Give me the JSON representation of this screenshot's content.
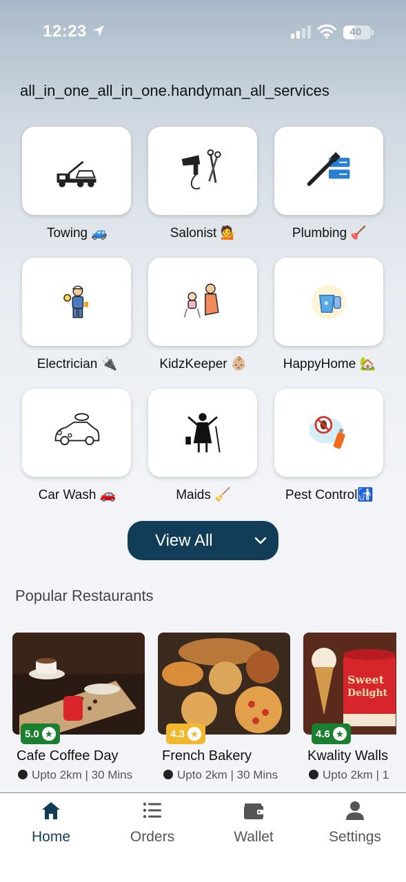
{
  "status_bar": {
    "time": "12:23",
    "battery": "40",
    "battery_level": 0.4
  },
  "app_title": "all_in_one_all_in_one.handyman_all_services",
  "services": [
    {
      "label": "Towing 🚙",
      "icon": "tow-truck-icon"
    },
    {
      "label": "Salonist 💁",
      "icon": "hair-dryer-icon"
    },
    {
      "label": "Plumbing 🪠",
      "icon": "wrench-pipe-icon"
    },
    {
      "label": "Electrician 🔌",
      "icon": "electrician-icon"
    },
    {
      "label": "KidzKeeper 👶🏼",
      "icon": "babysitter-icon"
    },
    {
      "label": "HappyHome 🏡",
      "icon": "cleaning-bucket-icon"
    },
    {
      "label": "Car Wash 🚗",
      "icon": "car-wash-icon"
    },
    {
      "label": "Maids 🧹",
      "icon": "maid-icon"
    },
    {
      "label": "Pest Control🚮",
      "icon": "pest-spray-icon"
    }
  ],
  "view_all": {
    "label": "View All"
  },
  "popular_restaurants": {
    "title": "Popular Restaurants",
    "items": [
      {
        "name": "Cafe Coffee Day",
        "rating": "5.0",
        "rating_color": "#1a7f2e",
        "meta": "Upto 2km | 30 Mins"
      },
      {
        "name": "French Bakery",
        "rating": "4.3",
        "rating_color": "#f2b72c",
        "meta": "Upto 2km | 30 Mins"
      },
      {
        "name": "Kwality Walls",
        "rating": "4.6",
        "rating_color": "#1a7f2e",
        "meta": "Upto 2km | 1"
      }
    ]
  },
  "tabs": [
    {
      "label": "Home",
      "icon": "home-icon",
      "active": true
    },
    {
      "label": "Orders",
      "icon": "list-icon",
      "active": false
    },
    {
      "label": "Wallet",
      "icon": "wallet-icon",
      "active": false
    },
    {
      "label": "Settings",
      "icon": "person-icon",
      "active": false
    }
  ],
  "colors": {
    "primary": "#123d59",
    "rating_green": "#1a7f2e",
    "rating_yellow": "#f2b72c"
  }
}
